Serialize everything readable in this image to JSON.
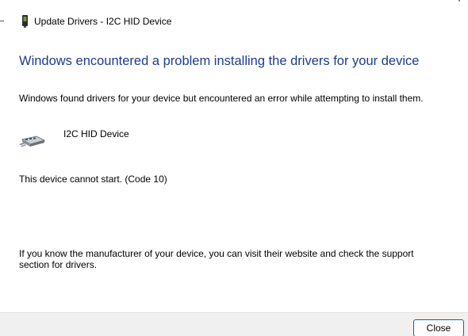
{
  "window": {
    "title": "Update Drivers - I2C HID Device",
    "title_icon": "device-manager-icon"
  },
  "content": {
    "headline": "Windows encountered a problem installing the drivers for your device",
    "description": "Windows found drivers for your device but encountered an error while attempting to install them.",
    "device": {
      "icon": "hid-device-icon",
      "name": "I2C HID Device"
    },
    "error_message": "This device cannot start. (Code 10)",
    "support_message": "If you know the manufacturer of your device, you can visit their website and check the support section for drivers."
  },
  "footer": {
    "close_label": "Close"
  },
  "colors": {
    "headline": "#1a3c8f",
    "footer_background": "#f0f0f0",
    "button_border": "#0067c0"
  }
}
